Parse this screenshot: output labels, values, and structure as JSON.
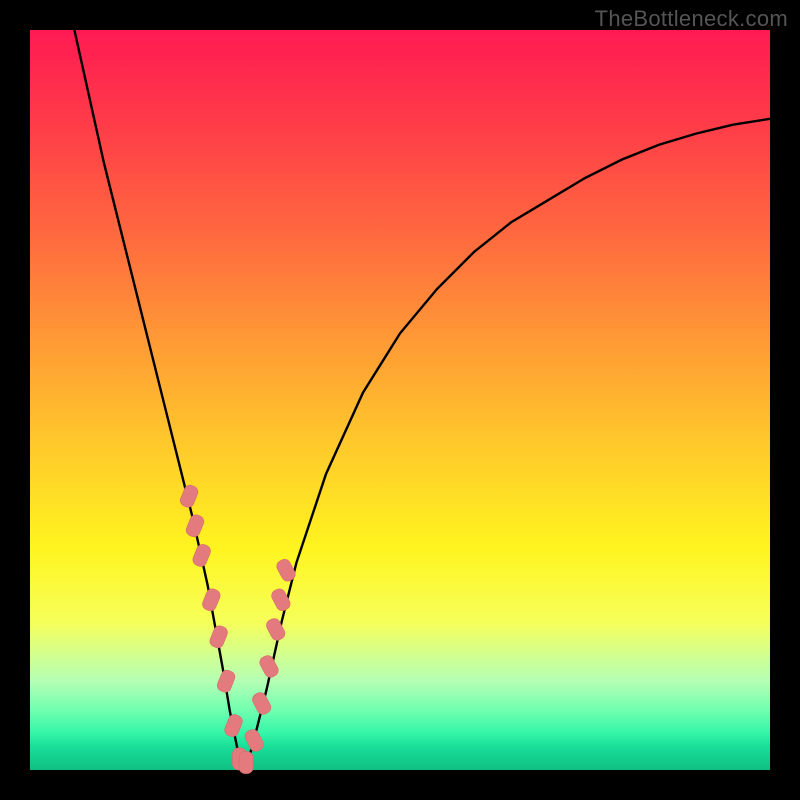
{
  "watermark": "TheBottleneck.com",
  "colors": {
    "curve_stroke": "#000000",
    "marker_fill": "#e37a7d",
    "marker_stroke": "#d86a6d",
    "frame_bg": "#000000"
  },
  "chart_data": {
    "type": "line",
    "title": "",
    "xlabel": "",
    "ylabel": "",
    "xlim": [
      0,
      100
    ],
    "ylim": [
      0,
      100
    ],
    "series": [
      {
        "name": "bottleneck-curve",
        "x": [
          6,
          8,
          10,
          12,
          14,
          16,
          18,
          20,
          22,
          24,
          26,
          27,
          28,
          29,
          30,
          32,
          34,
          36,
          40,
          45,
          50,
          55,
          60,
          65,
          70,
          75,
          80,
          85,
          90,
          95,
          100
        ],
        "values": [
          100,
          91,
          82,
          74,
          66,
          58,
          50,
          42,
          34,
          25,
          14,
          8,
          3,
          0,
          3,
          11,
          20,
          28,
          40,
          51,
          59,
          65,
          70,
          74,
          77,
          80,
          82.5,
          84.5,
          86,
          87.2,
          88
        ]
      }
    ],
    "markers": {
      "name": "highlight-points",
      "x": [
        21.5,
        22.3,
        23.2,
        24.5,
        25.5,
        26.5,
        27.5,
        28.3,
        29.2,
        30.3,
        31.3,
        32.3,
        33.2,
        33.9,
        34.6
      ],
      "values": [
        37,
        33,
        29,
        23,
        18,
        12,
        6,
        1.5,
        1,
        4,
        9,
        14,
        19,
        23,
        27
      ]
    }
  }
}
